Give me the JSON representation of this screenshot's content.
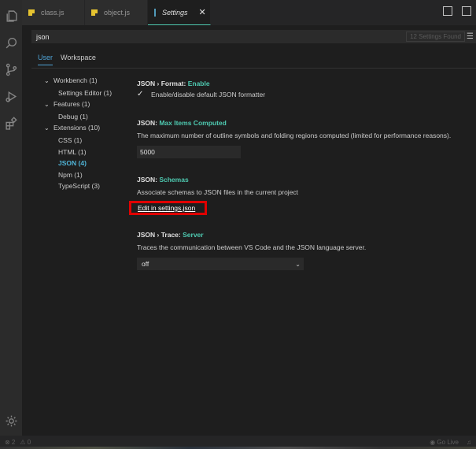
{
  "tabs": [
    {
      "label": "class.js",
      "icon": "js-file-icon"
    },
    {
      "label": "object.js",
      "icon": "js-file-icon"
    },
    {
      "label": "Settings",
      "icon": "file-icon",
      "close": "✕"
    }
  ],
  "search": {
    "query": "json",
    "found": "12 Settings Found"
  },
  "scope": {
    "user": "User",
    "workspace": "Workspace"
  },
  "tree": [
    {
      "label": "Workbench (1)",
      "level": 1,
      "chevron": "⌄"
    },
    {
      "label": "Settings Editor (1)",
      "level": 2
    },
    {
      "label": "Features (1)",
      "level": 1,
      "chevron": "⌄"
    },
    {
      "label": "Debug (1)",
      "level": 2
    },
    {
      "label": "Extensions (10)",
      "level": 1,
      "chevron": "⌄"
    },
    {
      "label": "CSS (1)",
      "level": 2
    },
    {
      "label": "HTML (1)",
      "level": 2
    },
    {
      "label": "JSON (4)",
      "level": 2,
      "active": true
    },
    {
      "label": "Npm (1)",
      "level": 2
    },
    {
      "label": "TypeScript (3)",
      "level": 2
    }
  ],
  "settings": {
    "format": {
      "prefix": "JSON › Format: ",
      "name": "Enable",
      "desc": "Enable/disable default JSON formatter",
      "check": "✓"
    },
    "max_items": {
      "prefix": "JSON: ",
      "name": "Max Items Computed",
      "desc": "The maximum number of outline symbols and folding regions computed (limited for performance reasons).",
      "value": "5000"
    },
    "schemas": {
      "prefix": "JSON: ",
      "name": "Schemas",
      "desc": "Associate schemas to JSON files in the current project",
      "link": "Edit in settings.json"
    },
    "trace": {
      "prefix": "JSON › Trace: ",
      "name": "Server",
      "desc": "Traces the communication between VS Code and the JSON language server.",
      "value": "off"
    }
  },
  "status": {
    "errors": "⊗ 2",
    "warnings": "⚠ 0",
    "golive": "Go Live"
  },
  "colors": {
    "accent": "#4ec9b0",
    "link_highlight": "#e00000",
    "background": "#1e1e1e"
  }
}
